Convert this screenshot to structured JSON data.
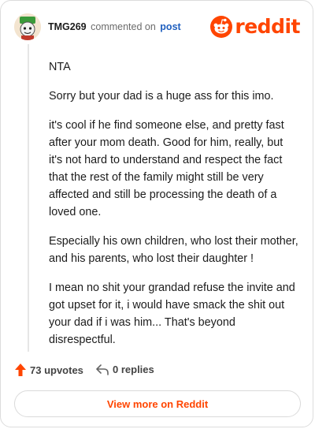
{
  "header": {
    "username": "TMG269",
    "action_text": "commented on",
    "post_link": "post",
    "logo_text": "reddit"
  },
  "comment": {
    "paragraphs": [
      "NTA",
      "Sorry but your dad is a huge ass for this imo.",
      "it's cool if he find someone else, and pretty fast after your mom death. Good for him, really, but it's not hard to understand and respect the fact that the rest of the family might still be very affected and still be processing the death of a loved one.",
      "Especially his own children, who lost their mother, and his parents, who lost their daughter !",
      "I mean no shit your grandad refuse the invite and got upset for it, i would have smack the shit out your dad if i was him... That's beyond disrespectful."
    ]
  },
  "actions": {
    "upvotes": "73 upvotes",
    "replies": "0 replies"
  },
  "view_more_label": "View more on Reddit",
  "colors": {
    "brand": "#ff4500",
    "link": "#1f5fbf",
    "muted": "#6b6b6b"
  }
}
